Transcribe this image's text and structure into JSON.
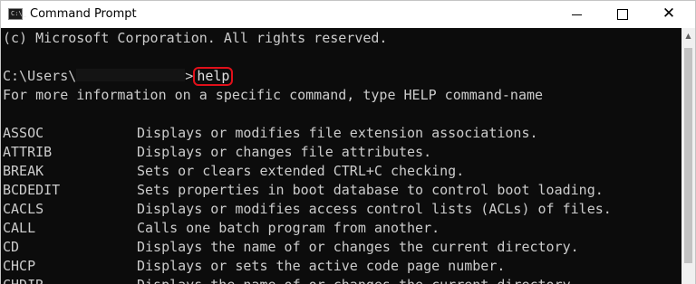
{
  "window": {
    "title": "Command Prompt",
    "icon_name": "console-icon",
    "icon_glyph": "C:\\_",
    "controls": {
      "minimize": "minimize-icon",
      "maximize": "maximize-icon",
      "close": "close-icon",
      "close_glyph": "✕"
    }
  },
  "console": {
    "copyright": "(c) Microsoft Corporation. All rights reserved.",
    "prompt_prefix": "C:\\Users\\",
    "prompt_suffix": ">",
    "typed_command": "help",
    "help_intro": "For more information on a specific command, type HELP command-name",
    "commands": [
      {
        "name": "ASSOC",
        "desc": "Displays or modifies file extension associations."
      },
      {
        "name": "ATTRIB",
        "desc": "Displays or changes file attributes."
      },
      {
        "name": "BREAK",
        "desc": "Sets or clears extended CTRL+C checking."
      },
      {
        "name": "BCDEDIT",
        "desc": "Sets properties in boot database to control boot loading."
      },
      {
        "name": "CACLS",
        "desc": "Displays or modifies access control lists (ACLs) of files."
      },
      {
        "name": "CALL",
        "desc": "Calls one batch program from another."
      },
      {
        "name": "CD",
        "desc": "Displays the name of or changes the current directory."
      },
      {
        "name": "CHCP",
        "desc": "Displays or sets the active code page number."
      },
      {
        "name": "CHDIR",
        "desc": "Displays the name of or changes the current directory."
      }
    ]
  },
  "colors": {
    "console_bg": "#0c0c0c",
    "console_text": "#cccccc",
    "highlight": "#e0101a"
  }
}
